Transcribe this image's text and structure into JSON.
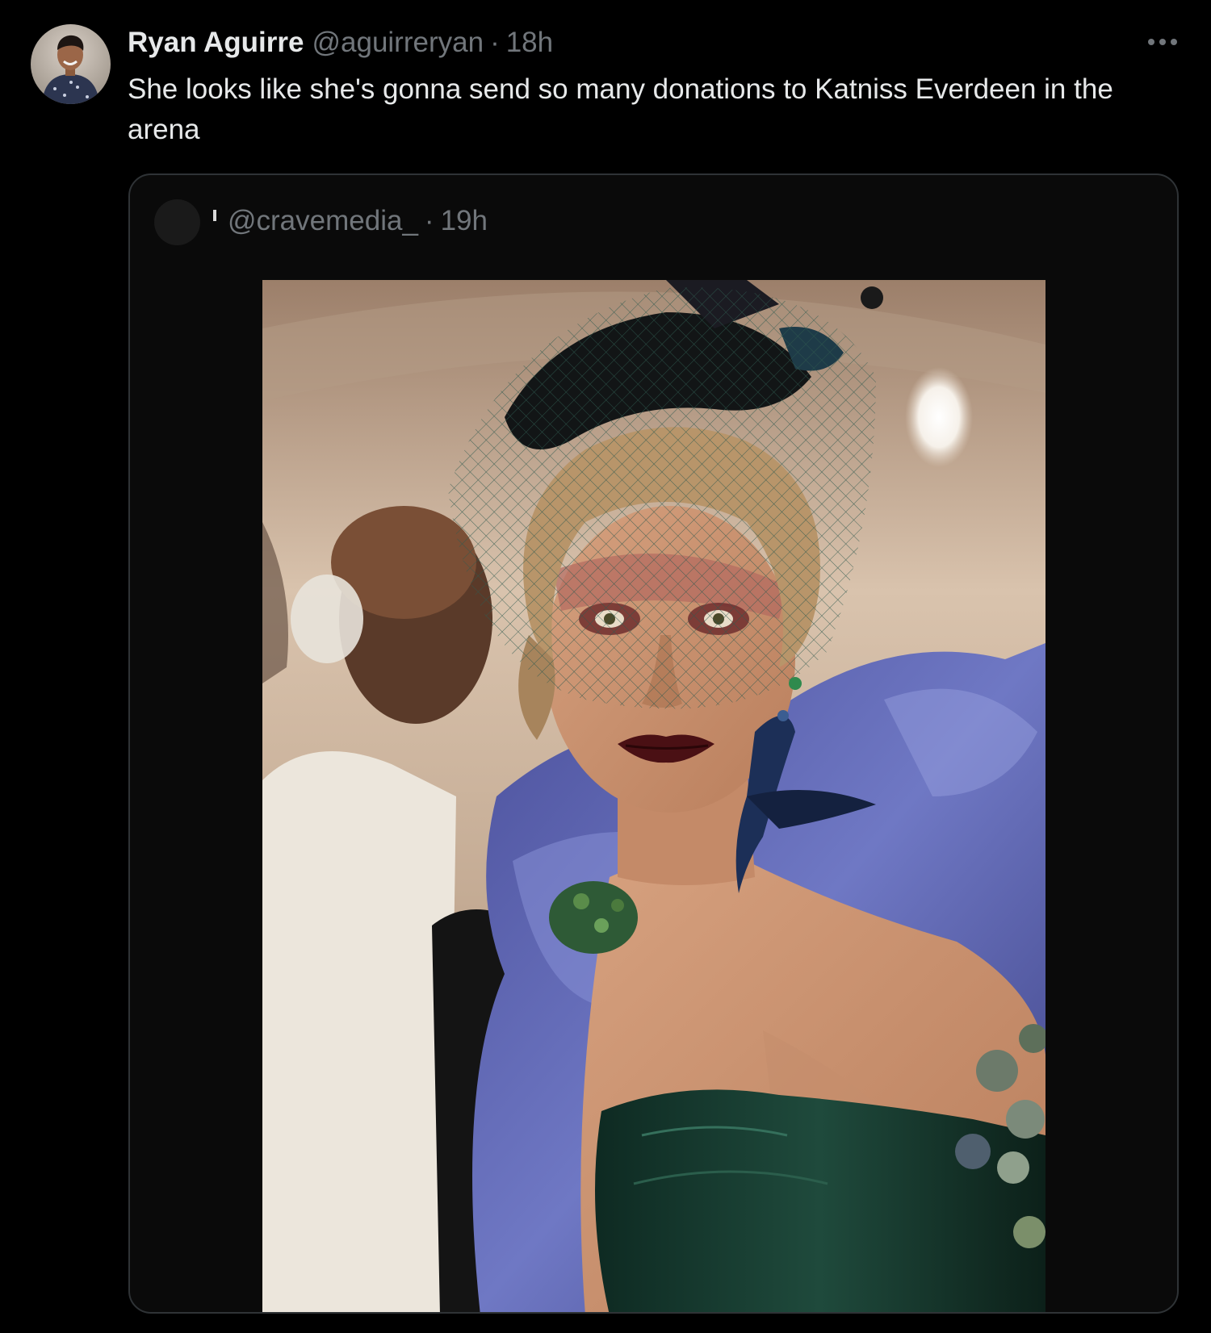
{
  "tweet": {
    "author": {
      "name": "Ryan Aguirre",
      "handle": "@aguirreryan",
      "separator": "·",
      "time": "18h"
    },
    "text": "She looks like she's gonna send so many donations to Katniss Everdeen in the arena",
    "more_icon": "ellipsis-icon",
    "quoted": {
      "handle": "@cravemedia_",
      "separator": "·",
      "time": "19h"
    }
  },
  "colors": {
    "background": "#000000",
    "text_primary": "#e7e9ea",
    "text_secondary": "#71767b",
    "border": "#2f3336"
  }
}
